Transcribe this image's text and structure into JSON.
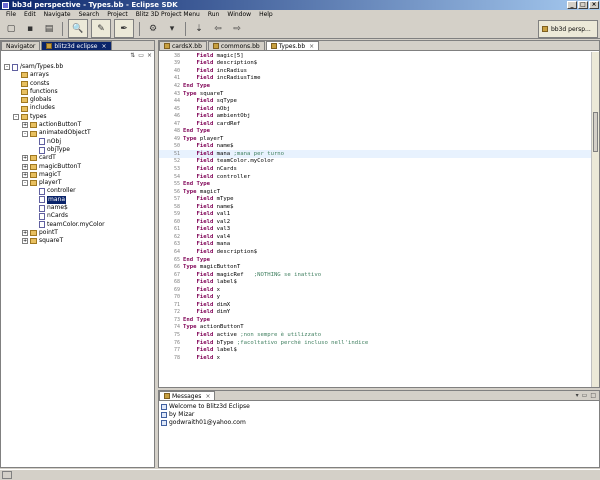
{
  "window": {
    "title": "bb3d perspective - Types.bb - Eclipse SDK"
  },
  "menu": [
    "File",
    "Edit",
    "Navigate",
    "Search",
    "Project",
    "Blitz 3D Project Menu",
    "Run",
    "Window",
    "Help"
  ],
  "perspective": {
    "label": "bb3d persp..."
  },
  "navigator": {
    "tabs": [
      "Navigator",
      "blitz3d eclipse"
    ],
    "tree": [
      {
        "label": "/sam/Types.bb",
        "depth": 0,
        "exp": "-",
        "icon": "file"
      },
      {
        "label": "arrays",
        "depth": 1,
        "exp": "",
        "icon": "folder"
      },
      {
        "label": "consts",
        "depth": 1,
        "exp": "",
        "icon": "folder"
      },
      {
        "label": "functions",
        "depth": 1,
        "exp": "",
        "icon": "folder"
      },
      {
        "label": "globals",
        "depth": 1,
        "exp": "",
        "icon": "folder"
      },
      {
        "label": "includes",
        "depth": 1,
        "exp": "",
        "icon": "folder"
      },
      {
        "label": "types",
        "depth": 1,
        "exp": "-",
        "icon": "folder"
      },
      {
        "label": "actionButtonT",
        "depth": 2,
        "exp": "+",
        "icon": "folder"
      },
      {
        "label": "animatedObjectT",
        "depth": 2,
        "exp": "-",
        "icon": "folder"
      },
      {
        "label": "nObj",
        "depth": 3,
        "exp": "",
        "icon": "file"
      },
      {
        "label": "objType",
        "depth": 3,
        "exp": "",
        "icon": "file"
      },
      {
        "label": "cardT",
        "depth": 2,
        "exp": "+",
        "icon": "folder"
      },
      {
        "label": "magicButtonT",
        "depth": 2,
        "exp": "+",
        "icon": "folder"
      },
      {
        "label": "magicT",
        "depth": 2,
        "exp": "+",
        "icon": "folder"
      },
      {
        "label": "playerT",
        "depth": 2,
        "exp": "-",
        "icon": "folder"
      },
      {
        "label": "controller",
        "depth": 3,
        "exp": "",
        "icon": "file"
      },
      {
        "label": "mana",
        "depth": 3,
        "exp": "",
        "icon": "file",
        "selected": true
      },
      {
        "label": "name$",
        "depth": 3,
        "exp": "",
        "icon": "file"
      },
      {
        "label": "nCards",
        "depth": 3,
        "exp": "",
        "icon": "file"
      },
      {
        "label": "teamColor.myColor",
        "depth": 3,
        "exp": "",
        "icon": "file"
      },
      {
        "label": "pointT",
        "depth": 2,
        "exp": "+",
        "icon": "folder"
      },
      {
        "label": "squareT",
        "depth": 2,
        "exp": "+",
        "icon": "folder"
      }
    ]
  },
  "editor": {
    "tabs": [
      "cardsX.bb",
      "commons.bb",
      "Types.bb"
    ],
    "active_tab": 2,
    "lines": [
      {
        "n": "38",
        "kw": "    Field",
        "rest": " magic[5]",
        "cm": ""
      },
      {
        "n": "39",
        "kw": "    Field",
        "rest": " description$",
        "cm": ""
      },
      {
        "n": "40",
        "kw": "    Field",
        "rest": " incRadius",
        "cm": ""
      },
      {
        "n": "41",
        "kw": "    Field",
        "rest": " incRadiusTime",
        "cm": ""
      },
      {
        "n": "42",
        "kw": "End Type",
        "rest": "",
        "cm": ""
      },
      {
        "n": "43",
        "kw": "Type",
        "rest": " squareT",
        "cm": ""
      },
      {
        "n": "44",
        "kw": "    Field",
        "rest": " sqType",
        "cm": ""
      },
      {
        "n": "45",
        "kw": "    Field",
        "rest": " nObj",
        "cm": ""
      },
      {
        "n": "46",
        "kw": "    Field",
        "rest": " ambientObj",
        "cm": ""
      },
      {
        "n": "47",
        "kw": "    Field",
        "rest": " cardRef",
        "cm": ""
      },
      {
        "n": "48",
        "kw": "End Type",
        "rest": "",
        "cm": ""
      },
      {
        "n": "49",
        "kw": "Type",
        "rest": " playerT",
        "cm": ""
      },
      {
        "n": "50",
        "kw": "    Field",
        "rest": " name$",
        "cm": ""
      },
      {
        "n": "51",
        "kw": "    Field",
        "rest": " mana ",
        "cm": ";mana per turno",
        "current": true
      },
      {
        "n": "52",
        "kw": "    Field",
        "rest": " teamColor.myColor",
        "cm": ""
      },
      {
        "n": "53",
        "kw": "    Field",
        "rest": " nCards",
        "cm": ""
      },
      {
        "n": "54",
        "kw": "    Field",
        "rest": " controller",
        "cm": ""
      },
      {
        "n": "55",
        "kw": "End Type",
        "rest": "",
        "cm": ""
      },
      {
        "n": "56",
        "kw": "Type",
        "rest": " magicT",
        "cm": ""
      },
      {
        "n": "57",
        "kw": "    Field",
        "rest": " mType",
        "cm": ""
      },
      {
        "n": "58",
        "kw": "    Field",
        "rest": " name$",
        "cm": ""
      },
      {
        "n": "59",
        "kw": "    Field",
        "rest": " val1",
        "cm": ""
      },
      {
        "n": "60",
        "kw": "    Field",
        "rest": " val2",
        "cm": ""
      },
      {
        "n": "61",
        "kw": "    Field",
        "rest": " val3",
        "cm": ""
      },
      {
        "n": "62",
        "kw": "    Field",
        "rest": " val4",
        "cm": ""
      },
      {
        "n": "63",
        "kw": "    Field",
        "rest": " mana",
        "cm": ""
      },
      {
        "n": "64",
        "kw": "    Field",
        "rest": " description$",
        "cm": ""
      },
      {
        "n": "65",
        "kw": "End Type",
        "rest": "",
        "cm": ""
      },
      {
        "n": "66",
        "kw": "Type",
        "rest": " magicButtonT",
        "cm": ""
      },
      {
        "n": "67",
        "kw": "    Field",
        "rest": " magicRef   ",
        "cm": ";NOTHING se inattivo"
      },
      {
        "n": "68",
        "kw": "    Field",
        "rest": " label$",
        "cm": ""
      },
      {
        "n": "69",
        "kw": "    Field",
        "rest": " x",
        "cm": ""
      },
      {
        "n": "70",
        "kw": "    Field",
        "rest": " y",
        "cm": ""
      },
      {
        "n": "71",
        "kw": "    Field",
        "rest": " dimX",
        "cm": ""
      },
      {
        "n": "72",
        "kw": "    Field",
        "rest": " dimY",
        "cm": ""
      },
      {
        "n": "73",
        "kw": "End Type",
        "rest": "",
        "cm": ""
      },
      {
        "n": "74",
        "kw": "Type",
        "rest": " actionButtonT",
        "cm": ""
      },
      {
        "n": "75",
        "kw": "    Field",
        "rest": " active ",
        "cm": ";non sempre è utilizzato"
      },
      {
        "n": "76",
        "kw": "    Field",
        "rest": " bType ",
        "cm": ";facoltativo perchè incluso nell'indice"
      },
      {
        "n": "77",
        "kw": "    Field",
        "rest": " label$",
        "cm": ""
      },
      {
        "n": "78",
        "kw": "    Field",
        "rest": " x",
        "cm": ""
      }
    ]
  },
  "messages": {
    "tab": "Messages",
    "items": [
      "Welcome to Blitz3d Eclipse",
      "by Mizar",
      "godwraith01@yahoo.com"
    ]
  }
}
